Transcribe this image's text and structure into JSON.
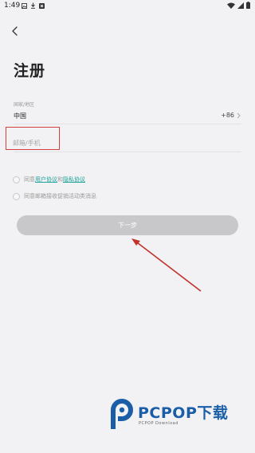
{
  "status_bar": {
    "time": "1:49"
  },
  "page": {
    "title": "注册"
  },
  "region": {
    "label": "国家/地区",
    "country": "中国",
    "code": "+86"
  },
  "input": {
    "placeholder": "邮箱/手机",
    "value": ""
  },
  "agreements": {
    "prefix": "同意",
    "user_agreement": "用户协议",
    "and": "和",
    "privacy_agreement": "隐私协议",
    "marketing": "同意邮箱接收促销活动类消息"
  },
  "next_button": {
    "label": "下一步"
  },
  "watermark": {
    "brand": "PCPOP下载",
    "sub": "PCPOP Download"
  },
  "colors": {
    "link": "#1aa39a",
    "highlight_box": "#d23f3f",
    "button_disabled": "#c8c8ca",
    "brand_blue": "#1b5ea8"
  }
}
